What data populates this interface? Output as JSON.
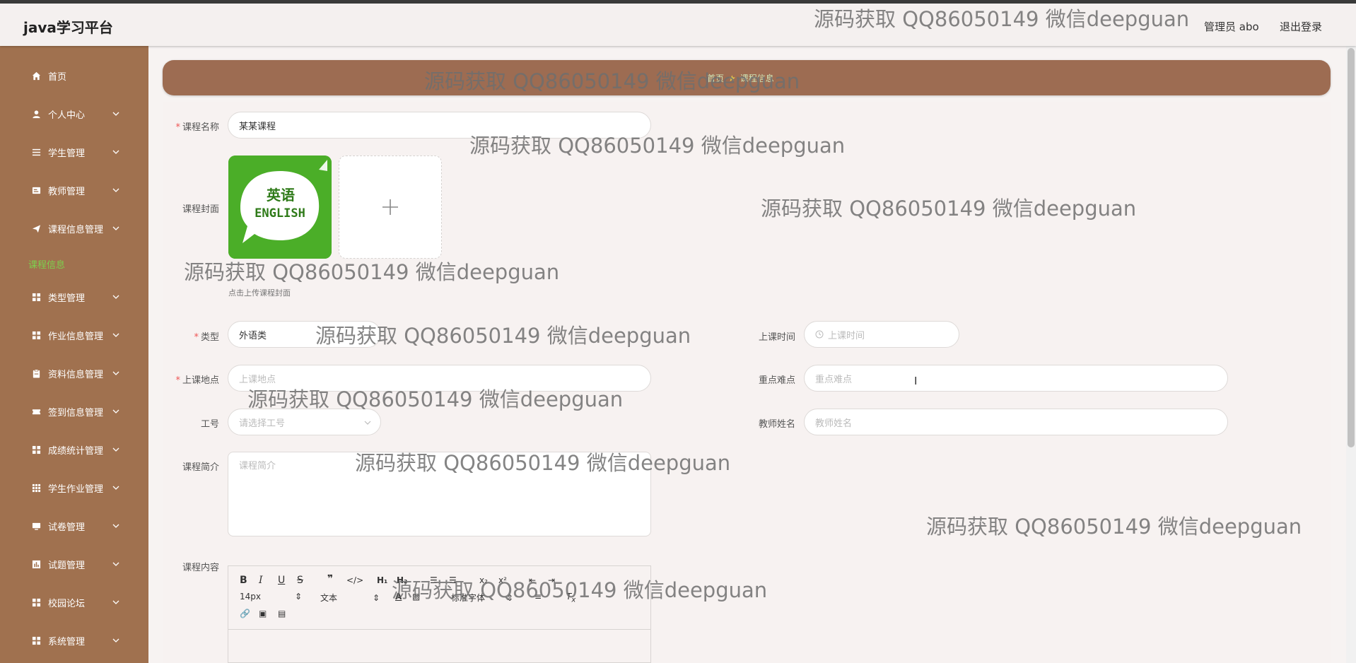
{
  "header": {
    "brand": "java学习平台",
    "admin_label": "管理员 abo",
    "logout_label": "退出登录"
  },
  "sidebar": {
    "items": [
      {
        "label": "首页",
        "icon": "home-icon"
      },
      {
        "label": "个人中心",
        "icon": "user-icon"
      },
      {
        "label": "学生管理",
        "icon": "list-icon"
      },
      {
        "label": "教师管理",
        "icon": "card-icon"
      },
      {
        "label": "课程信息管理",
        "icon": "send-icon"
      },
      {
        "label": "类型管理",
        "icon": "grid-icon"
      },
      {
        "label": "作业信息管理",
        "icon": "grid-icon"
      },
      {
        "label": "资料信息管理",
        "icon": "clipboard-icon"
      },
      {
        "label": "签到信息管理",
        "icon": "ticket-icon"
      },
      {
        "label": "成绩统计管理",
        "icon": "grid-icon"
      },
      {
        "label": "学生作业管理",
        "icon": "apps-icon"
      },
      {
        "label": "试卷管理",
        "icon": "monitor-icon"
      },
      {
        "label": "试题管理",
        "icon": "chart-icon"
      },
      {
        "label": "校园论坛",
        "icon": "grid-icon"
      },
      {
        "label": "系统管理",
        "icon": "grid-icon"
      }
    ],
    "sub_active": "课程信息"
  },
  "breadcrumb": {
    "home": "首页",
    "current": "课程信息"
  },
  "form": {
    "name": {
      "label": "课程名称",
      "value": "某某课程"
    },
    "cover": {
      "label": "课程封面",
      "tip": "点击上传课程封面",
      "image_text_1": "英语",
      "image_text_2": "ENGLISH"
    },
    "type": {
      "label": "类型",
      "value": "外语类"
    },
    "time": {
      "label": "上课时间",
      "placeholder": "上课时间"
    },
    "place": {
      "label": "上课地点",
      "placeholder": "上课地点"
    },
    "keypoint": {
      "label": "重点难点",
      "placeholder": "重点难点"
    },
    "job_no": {
      "label": "工号",
      "placeholder": "请选择工号"
    },
    "teacher": {
      "label": "教师姓名",
      "placeholder": "教师姓名"
    },
    "intro": {
      "label": "课程简介",
      "placeholder": "课程简介"
    },
    "content": {
      "label": "课程内容"
    }
  },
  "editor": {
    "font_size": "14px",
    "block_type": "文本",
    "font_family": "标准字体"
  },
  "watermark": "源码获取 QQ86050149 微信deepguan"
}
